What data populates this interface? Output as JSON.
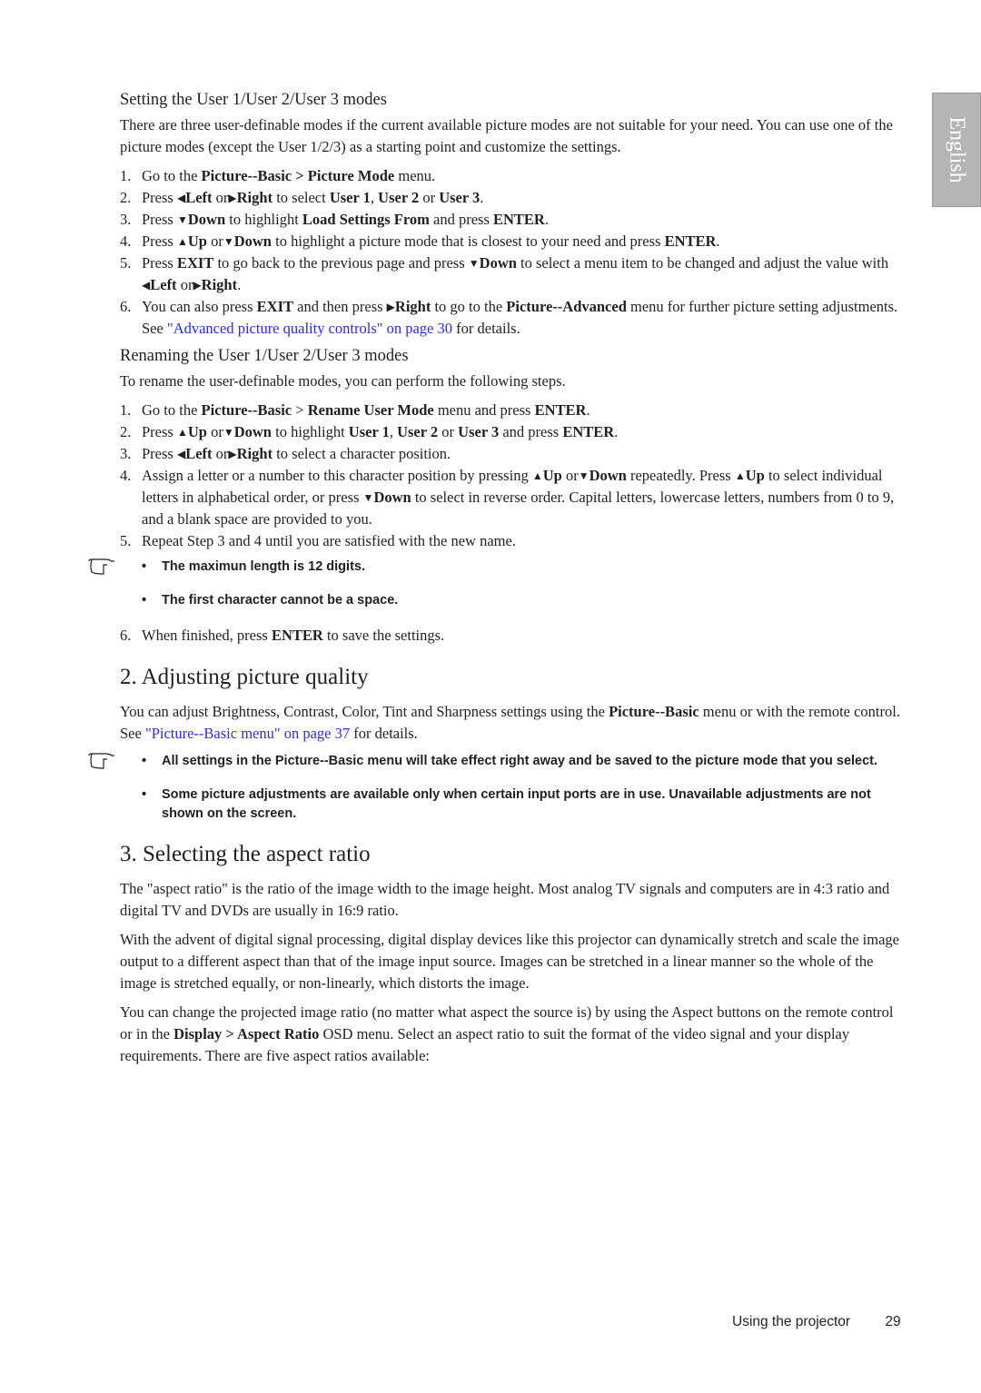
{
  "side_tab": {
    "label": "English"
  },
  "section_user_modes": {
    "heading": "Setting the User 1/User 2/User 3 modes",
    "intro": "There are three user-definable modes if the current available picture modes are not suitable for your need. You can use one of the picture modes (except the User 1/2/3) as a starting point and customize the settings.",
    "steps": [
      {
        "num": "1.",
        "parts": [
          "Go to the ",
          "Picture--Basic > Picture Mode",
          " menu."
        ]
      },
      {
        "num": "2.",
        "html": "Press <span class='arr'>◀</span><b>Left</b> or<span class='arr'>▶</span><b>Right</b> to select <b>User 1</b>, <b>User 2</b> or <b>User 3</b>."
      },
      {
        "num": "3.",
        "html": "Press <span class='arr'>▼</span><b>Down</b> to highlight <b>Load Settings From</b> and press <b>ENTER</b>."
      },
      {
        "num": "4.",
        "html": "Press <span class='arr'>▲</span><b>Up</b> or<span class='arr'>▼</span><b>Down</b> to highlight a picture mode that is closest to your need and press <b>ENTER</b>."
      },
      {
        "num": "5.",
        "html": "Press <b>EXIT</b> to go back to the previous page and press <span class='arr'>▼</span><b>Down</b> to select a menu item to be changed and adjust the value with <span class='arr'>◀</span><b>Left</b> or<span class='arr'>▶</span><b>Right</b>."
      },
      {
        "num": "6.",
        "html": "You can also press <b>EXIT</b> and then press <span class='arr'>▶</span><b>Right</b> to go to the <b>Picture--Advanced</b> menu for further picture setting adjustments. See <span class='link'>\"Advanced picture quality controls\" on page 30</span> for details."
      }
    ]
  },
  "section_rename": {
    "heading": "Renaming the User 1/User 2/User 3 modes",
    "intro": "To rename the user-definable modes, you can perform the following steps.",
    "steps": [
      {
        "num": "1.",
        "html": "Go to the <b>Picture--Basic</b> &gt; <b>Rename User Mode</b> menu and press <b>ENTER</b>."
      },
      {
        "num": "2.",
        "html": "Press <span class='arr'>▲</span><b>Up</b> or<span class='arr'>▼</span><b>Down</b> to highlight <b>User 1</b>, <b>User 2</b> or <b>User 3</b> and press <b>ENTER</b>."
      },
      {
        "num": "3.",
        "html": "Press <span class='arr'>◀</span><b>Left</b> or<span class='arr'>▶</span><b>Right</b> to select a character position."
      },
      {
        "num": "4.",
        "html": "Assign a letter or a number to this character position by pressing <span class='arr'>▲</span><b>Up</b> or<span class='arr'>▼</span><b>Down</b> repeatedly. Press <span class='arr'>▲</span><b>Up</b> to select individual letters in alphabetical order, or press <span class='arr'>▼</span><b>Down</b> to select in reverse order. Capital letters, lowercase letters, numbers from 0 to 9, and a blank space are provided to you."
      },
      {
        "num": "5.",
        "html": "Repeat Step 3 and 4 until you are satisfied with the new name."
      }
    ],
    "notes": [
      "The maximun length is 12 digits.",
      "The first character cannot be a space."
    ],
    "final_step": {
      "num": "6.",
      "html": "When finished, press <b>ENTER</b> to save the settings."
    }
  },
  "section_quality": {
    "heading": "2. Adjusting picture quality",
    "body_html": "You can adjust Brightness, Contrast, Color, Tint and Sharpness settings using the <b>Picture--Basic</b> menu or with the remote control. See <span class='link'>\"Picture--Basic menu\" on page 37</span> for details.",
    "notes": [
      "All settings in the Picture--Basic menu will take effect right away and be saved to the picture mode that you select.",
      "Some picture adjustments are available only when certain input ports are in use. Unavailable adjustments are not shown on the screen."
    ]
  },
  "section_aspect": {
    "heading": "3. Selecting the aspect ratio",
    "paragraphs": [
      "The \"aspect ratio\" is the ratio of the image width to the image height. Most analog TV signals and computers are in 4:3 ratio and digital TV and DVDs are usually in 16:9 ratio.",
      "With the advent of digital signal processing, digital display devices like this projector can dynamically stretch and scale the image output to a different aspect than that of the image input source. Images can be stretched in a linear manner so the whole of the image is stretched equally, or non-linearly, which distorts the image."
    ],
    "last_paragraph_html": "You can change the projected image ratio (no matter what aspect the source is) by using the Aspect buttons on the remote control or in the <b>Display &gt; Aspect Ratio</b> OSD menu. Select an aspect ratio to suit the format of the video signal and your display requirements. There are five aspect ratios available:"
  },
  "footer": {
    "section": "Using the projector",
    "page_number": "29"
  }
}
